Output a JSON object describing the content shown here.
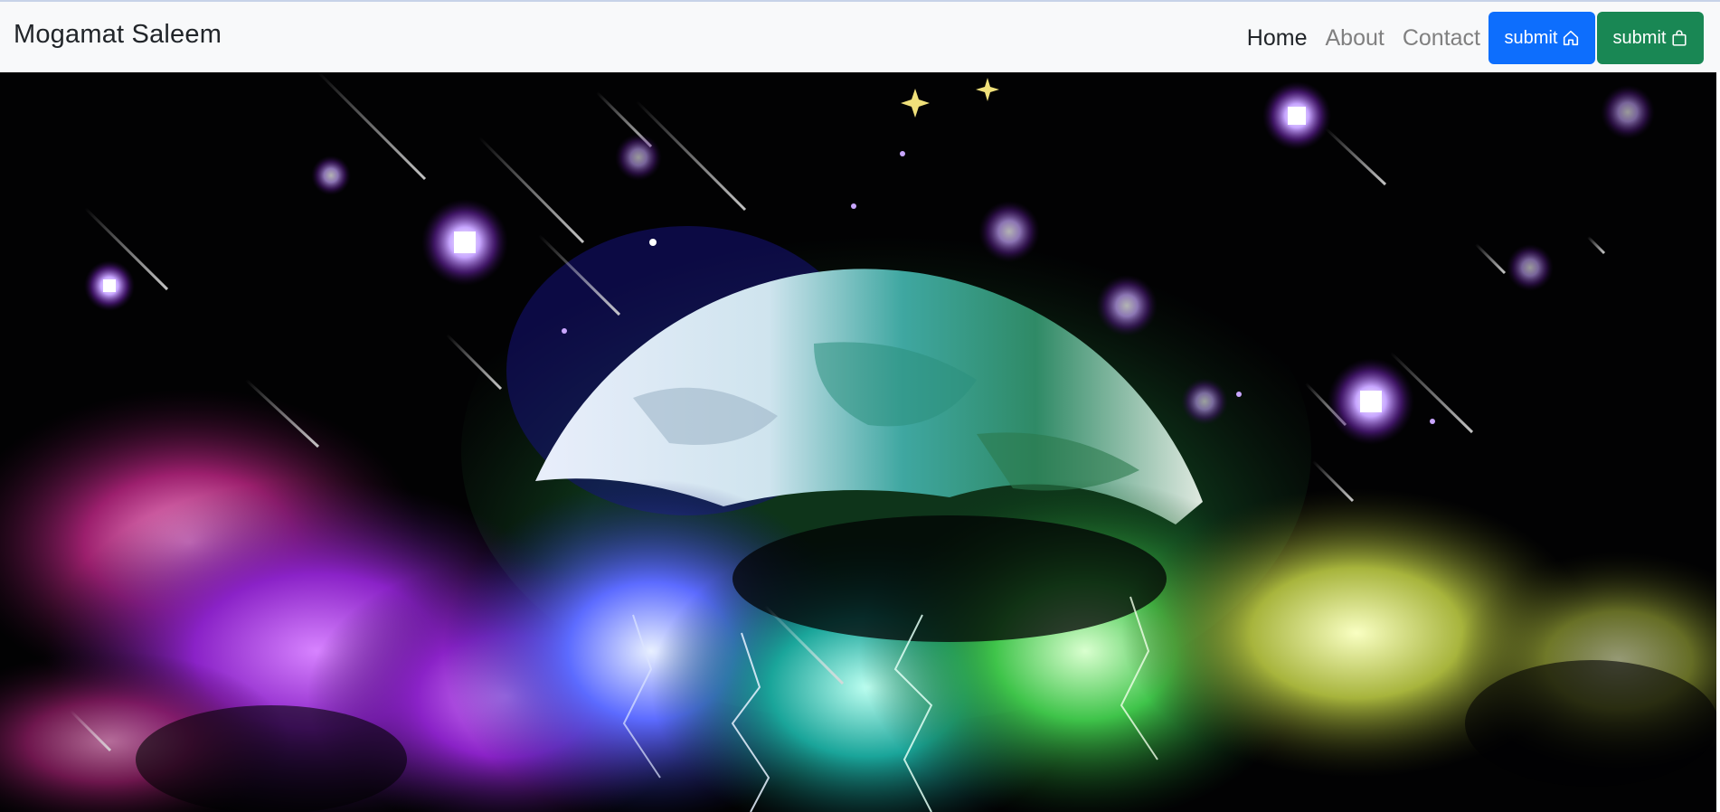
{
  "navbar": {
    "brand": "Mogamat Saleem",
    "links": [
      {
        "label": "Home",
        "active": true
      },
      {
        "label": "About",
        "active": false
      },
      {
        "label": "Contact",
        "active": false
      }
    ],
    "buttons": [
      {
        "label": "submit",
        "icon": "house-icon",
        "color": "#0d6efd"
      },
      {
        "label": "submit",
        "icon": "bag-icon",
        "color": "#198754"
      }
    ]
  },
  "hero": {
    "image": "space-moon-storm-illustration"
  },
  "colors": {
    "navbar_bg": "#f8f9fa",
    "primary": "#0d6efd",
    "success": "#198754",
    "hero_bg": "#020203"
  }
}
